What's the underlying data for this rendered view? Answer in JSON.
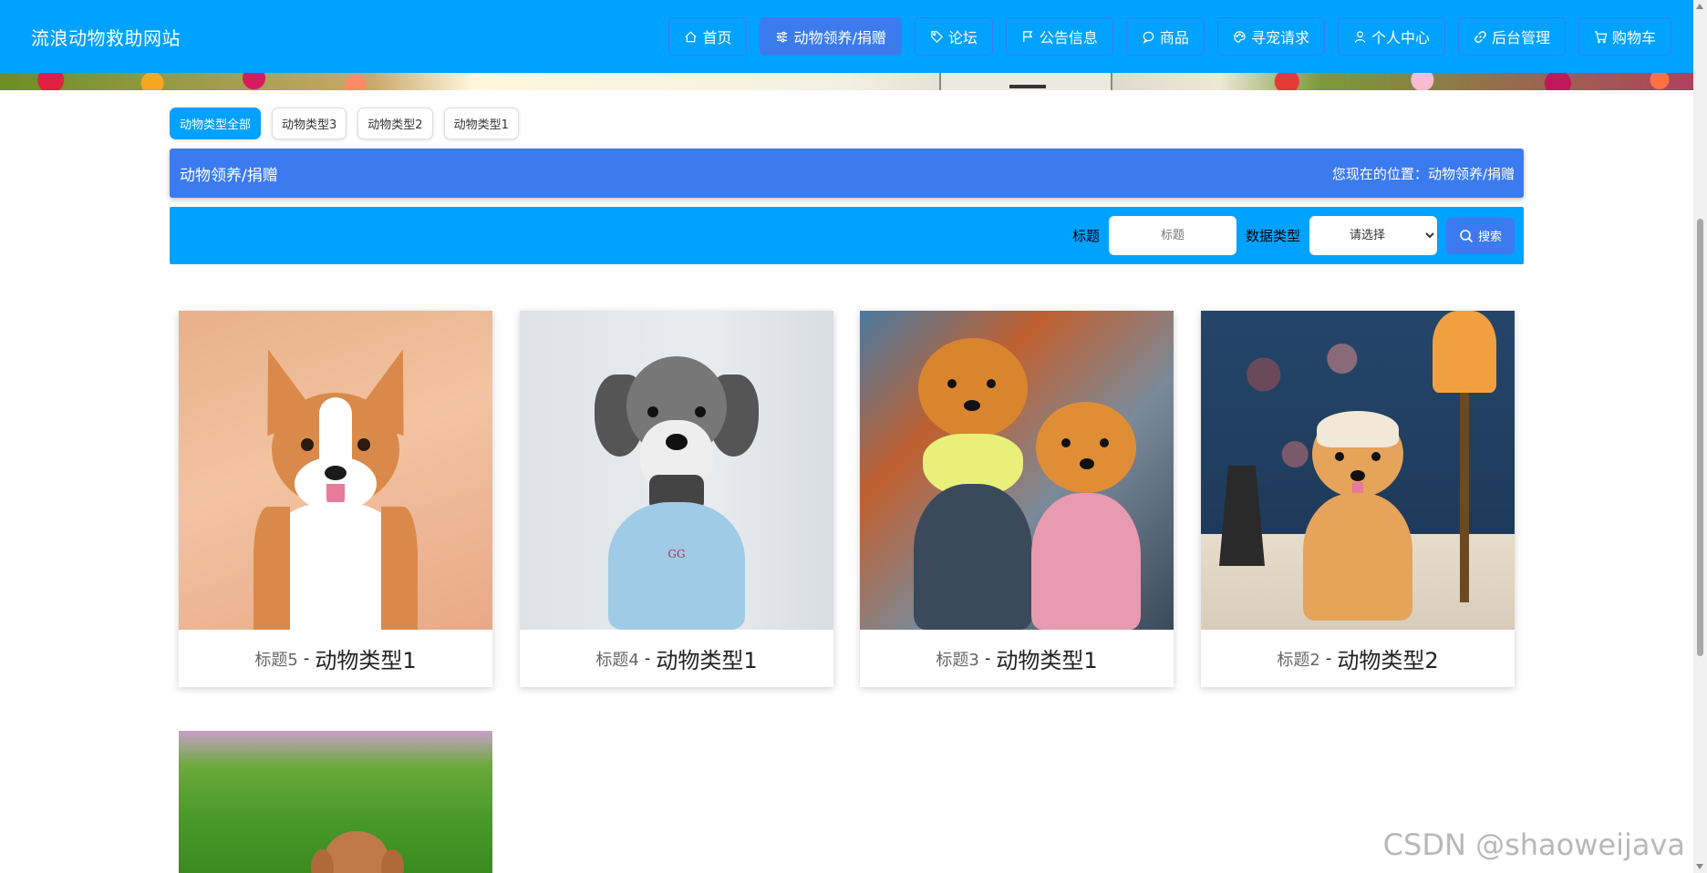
{
  "site": {
    "title": "流浪动物救助网站"
  },
  "nav": {
    "items": [
      {
        "label": "首页",
        "icon": "home-icon"
      },
      {
        "label": "动物领养/捐赠",
        "icon": "sliders-icon",
        "active": true
      },
      {
        "label": "论坛",
        "icon": "tag-icon"
      },
      {
        "label": "公告信息",
        "icon": "flag-icon"
      },
      {
        "label": "商品",
        "icon": "chat-icon"
      },
      {
        "label": "寻宠请求",
        "icon": "palette-icon"
      },
      {
        "label": "个人中心",
        "icon": "user-icon"
      },
      {
        "label": "后台管理",
        "icon": "link-icon"
      },
      {
        "label": "购物车",
        "icon": "cart-icon"
      }
    ]
  },
  "categories": {
    "items": [
      {
        "label": "动物类型全部",
        "active": true
      },
      {
        "label": "动物类型3"
      },
      {
        "label": "动物类型2"
      },
      {
        "label": "动物类型1"
      }
    ]
  },
  "breadcrumb": {
    "title": "动物领养/捐赠",
    "location_label": "您现在的位置：",
    "location_value": "动物领养/捐赠"
  },
  "search": {
    "title_label": "标题",
    "title_placeholder": "标题",
    "type_label": "数据类型",
    "type_selected": "请选择",
    "button_label": "搜索"
  },
  "cards": [
    {
      "title": "标题5",
      "separator": "-",
      "type": "动物类型1"
    },
    {
      "title": "标题4",
      "separator": "-",
      "type": "动物类型1"
    },
    {
      "title": "标题3",
      "separator": "-",
      "type": "动物类型1"
    },
    {
      "title": "标题2",
      "separator": "-",
      "type": "动物类型2"
    },
    {
      "title": "",
      "separator": "",
      "type": ""
    }
  ],
  "watermark": "CSDN @shaoweijava",
  "colors": {
    "primary": "#00a2ff",
    "accent": "#3c7bef"
  }
}
